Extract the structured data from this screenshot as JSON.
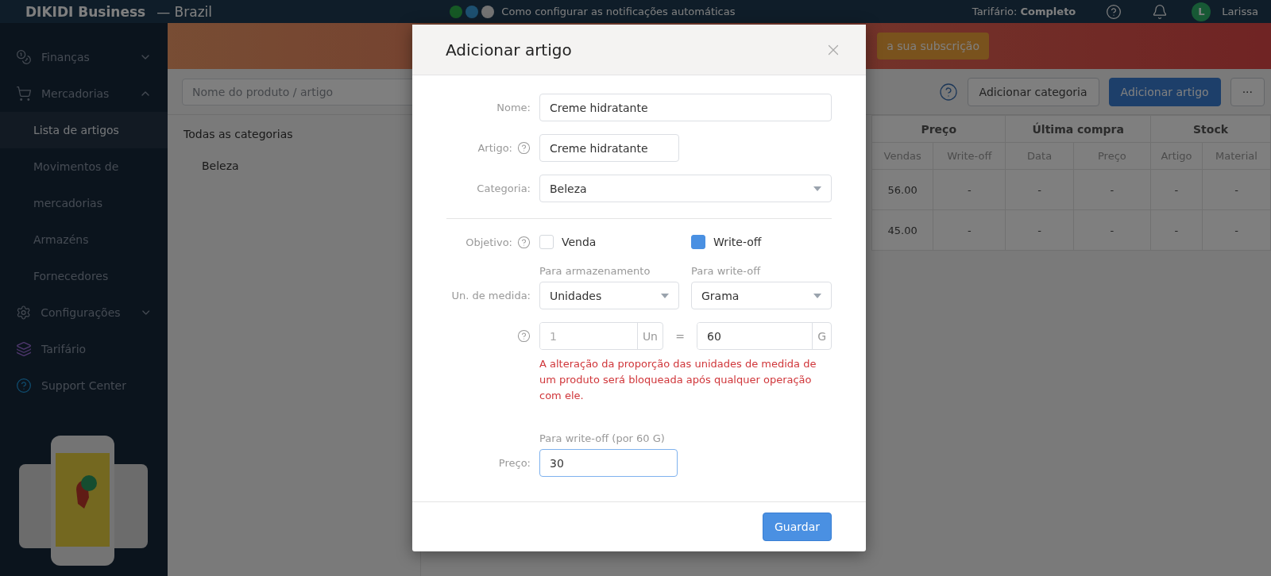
{
  "header": {
    "logo": "DIKIDI Business",
    "region": "— Brazil",
    "notice": "Como configurar as notificações automáticas",
    "plan": "Tarifário: **Completo**",
    "user_initial": "L",
    "user_name": "Larissa"
  },
  "banner": {
    "button": "a sua subscrição"
  },
  "sidebar": {
    "items": [
      {
        "label": "Finanças",
        "expanded": false
      },
      {
        "label": "Mercadorias",
        "expanded": true,
        "children": [
          {
            "label": "Lista de artigos",
            "selected": true
          },
          {
            "label": "Movimentos de mercadorias",
            "selected": false
          },
          {
            "label": "Armazéns",
            "selected": false
          },
          {
            "label": "Fornecedores",
            "selected": false
          }
        ]
      },
      {
        "label": "Configurações",
        "expanded": false
      },
      {
        "label": "Tarifário"
      },
      {
        "label": "Support Center"
      }
    ]
  },
  "toolbar": {
    "search_placeholder": "Nome do produto / artigo",
    "buttons": [
      {
        "label": "Adicionar categoria",
        "kind": "secondary"
      },
      {
        "label": "Adicionar artigo",
        "kind": "primary"
      },
      {
        "label": "···",
        "kind": "secondary"
      }
    ]
  },
  "categories": [
    {
      "label": "Todas as categorias",
      "children": [
        {
          "label": "Beleza"
        }
      ]
    }
  ],
  "table": {
    "groups": [
      "Preço",
      "Última compra",
      "Stock"
    ],
    "columns": [
      "Vendas",
      "Write-off",
      "Data",
      "Preço",
      "Artigo",
      "Material"
    ],
    "rows": [
      [
        "56.00",
        "-",
        "-",
        "-",
        "-",
        "-"
      ],
      [
        "45.00",
        "-",
        "-",
        "-",
        "-",
        "-"
      ]
    ]
  },
  "modal": {
    "title": "Adicionar artigo",
    "name": {
      "label": "Nome:",
      "value": "Creme hidratante"
    },
    "article": {
      "label": "Artigo:",
      "value": "Creme hidratante"
    },
    "category": {
      "label": "Categoria:",
      "value": "Beleza"
    },
    "objective": {
      "label": "Objetivo:",
      "options": [
        {
          "label": "Venda",
          "checked": false
        },
        {
          "label": "Write-off",
          "checked": true
        }
      ]
    },
    "units": {
      "label": "Un. de medida:",
      "storage_caption": "Para armazenamento",
      "writeoff_caption": "Para write-off",
      "storage_value": "Unidades",
      "writeoff_value": "Grama"
    },
    "ratio": {
      "left_value": "1",
      "left_unit": "Un",
      "left_disabled": true,
      "equals": "=",
      "right_value": "60",
      "right_unit": "G",
      "warning": "A alteração da proporção das unidades de medida de um produto será bloqueada após qualquer operação com ele."
    },
    "price": {
      "caption": "Para write-off (por 60 G)",
      "label": "Preço:",
      "value": "30",
      "focused": true
    },
    "save_button": "Guardar"
  }
}
